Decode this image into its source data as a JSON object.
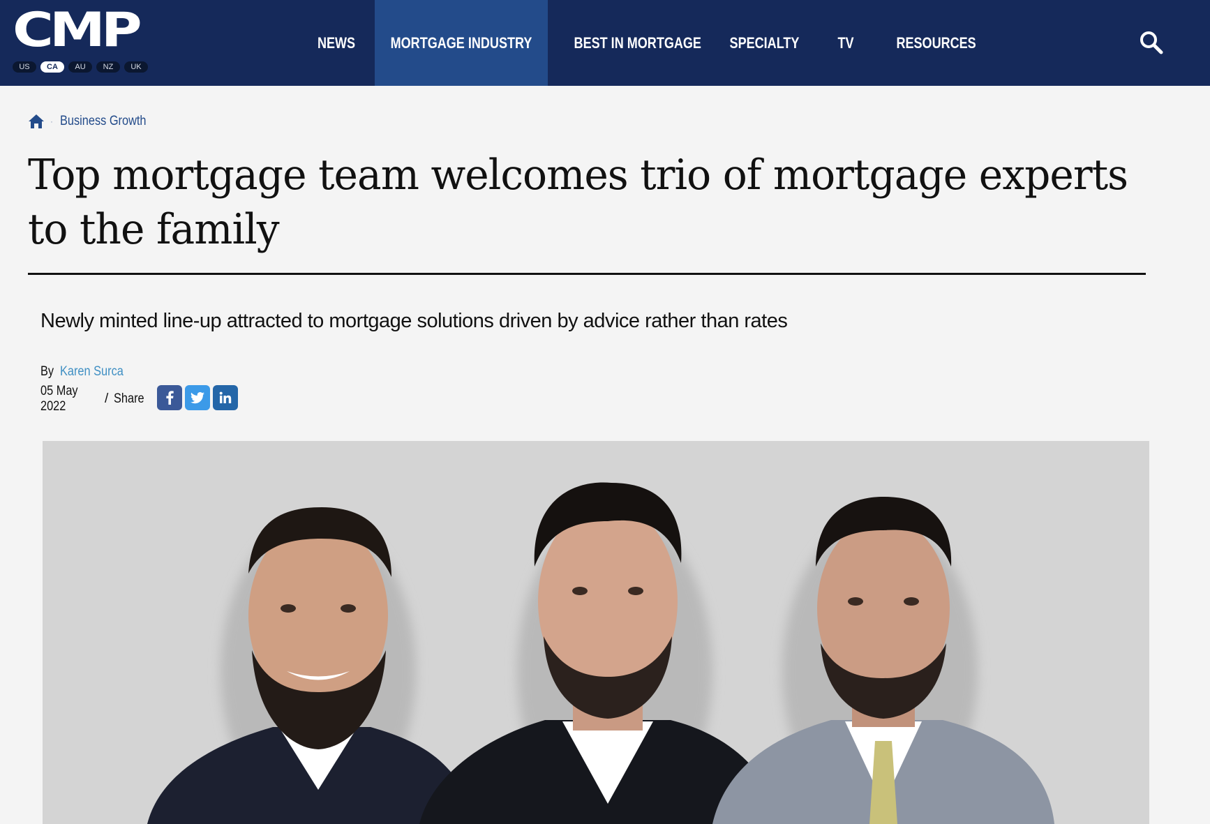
{
  "header": {
    "logo_text": "CMP",
    "regions": [
      {
        "label": "US",
        "active": false
      },
      {
        "label": "CA",
        "active": true
      },
      {
        "label": "AU",
        "active": false
      },
      {
        "label": "NZ",
        "active": false
      },
      {
        "label": "UK",
        "active": false
      }
    ],
    "nav": [
      {
        "label": "NEWS"
      },
      {
        "label": "MORTGAGE INDUSTRY",
        "active": true
      },
      {
        "label": "BEST IN MORTGAGE"
      },
      {
        "label": "SPECIALTY"
      },
      {
        "label": "TV"
      },
      {
        "label": "RESOURCES"
      }
    ],
    "search_icon": "search-icon"
  },
  "breadcrumb": {
    "home_icon": "home-icon",
    "separator": "·",
    "section": "Business Growth"
  },
  "article": {
    "title": "Top mortgage team welcomes trio of mortgage experts to the family",
    "subtitle": "Newly minted line-up attracted to mortgage solutions driven by advice rather than rates",
    "by_label": "By",
    "author": "Karen Surca",
    "date": "05 May 2022",
    "meta_separator": "/",
    "share_label": "Share",
    "share_icons": [
      "facebook-icon",
      "twitter-icon",
      "linkedin-icon"
    ]
  },
  "colors": {
    "header_bg": "#15295a",
    "nav_active_bg": "#234b8a",
    "page_bg": "#f4f4f4",
    "link_blue": "#3f8fc3",
    "facebook": "#3b5998",
    "twitter": "#3c9ae8",
    "linkedin": "#2466a8"
  }
}
